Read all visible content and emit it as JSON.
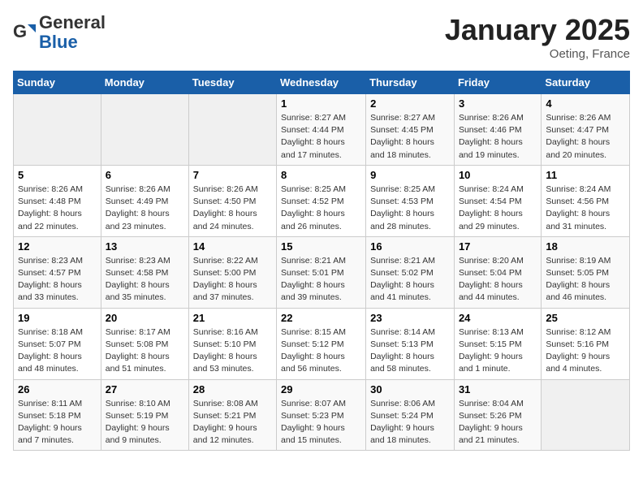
{
  "header": {
    "logo_general": "General",
    "logo_blue": "Blue",
    "month": "January 2025",
    "location": "Oeting, France"
  },
  "weekdays": [
    "Sunday",
    "Monday",
    "Tuesday",
    "Wednesday",
    "Thursday",
    "Friday",
    "Saturday"
  ],
  "weeks": [
    [
      {
        "day": "",
        "info": ""
      },
      {
        "day": "",
        "info": ""
      },
      {
        "day": "",
        "info": ""
      },
      {
        "day": "1",
        "info": "Sunrise: 8:27 AM\nSunset: 4:44 PM\nDaylight: 8 hours and 17 minutes."
      },
      {
        "day": "2",
        "info": "Sunrise: 8:27 AM\nSunset: 4:45 PM\nDaylight: 8 hours and 18 minutes."
      },
      {
        "day": "3",
        "info": "Sunrise: 8:26 AM\nSunset: 4:46 PM\nDaylight: 8 hours and 19 minutes."
      },
      {
        "day": "4",
        "info": "Sunrise: 8:26 AM\nSunset: 4:47 PM\nDaylight: 8 hours and 20 minutes."
      }
    ],
    [
      {
        "day": "5",
        "info": "Sunrise: 8:26 AM\nSunset: 4:48 PM\nDaylight: 8 hours and 22 minutes."
      },
      {
        "day": "6",
        "info": "Sunrise: 8:26 AM\nSunset: 4:49 PM\nDaylight: 8 hours and 23 minutes."
      },
      {
        "day": "7",
        "info": "Sunrise: 8:26 AM\nSunset: 4:50 PM\nDaylight: 8 hours and 24 minutes."
      },
      {
        "day": "8",
        "info": "Sunrise: 8:25 AM\nSunset: 4:52 PM\nDaylight: 8 hours and 26 minutes."
      },
      {
        "day": "9",
        "info": "Sunrise: 8:25 AM\nSunset: 4:53 PM\nDaylight: 8 hours and 28 minutes."
      },
      {
        "day": "10",
        "info": "Sunrise: 8:24 AM\nSunset: 4:54 PM\nDaylight: 8 hours and 29 minutes."
      },
      {
        "day": "11",
        "info": "Sunrise: 8:24 AM\nSunset: 4:56 PM\nDaylight: 8 hours and 31 minutes."
      }
    ],
    [
      {
        "day": "12",
        "info": "Sunrise: 8:23 AM\nSunset: 4:57 PM\nDaylight: 8 hours and 33 minutes."
      },
      {
        "day": "13",
        "info": "Sunrise: 8:23 AM\nSunset: 4:58 PM\nDaylight: 8 hours and 35 minutes."
      },
      {
        "day": "14",
        "info": "Sunrise: 8:22 AM\nSunset: 5:00 PM\nDaylight: 8 hours and 37 minutes."
      },
      {
        "day": "15",
        "info": "Sunrise: 8:21 AM\nSunset: 5:01 PM\nDaylight: 8 hours and 39 minutes."
      },
      {
        "day": "16",
        "info": "Sunrise: 8:21 AM\nSunset: 5:02 PM\nDaylight: 8 hours and 41 minutes."
      },
      {
        "day": "17",
        "info": "Sunrise: 8:20 AM\nSunset: 5:04 PM\nDaylight: 8 hours and 44 minutes."
      },
      {
        "day": "18",
        "info": "Sunrise: 8:19 AM\nSunset: 5:05 PM\nDaylight: 8 hours and 46 minutes."
      }
    ],
    [
      {
        "day": "19",
        "info": "Sunrise: 8:18 AM\nSunset: 5:07 PM\nDaylight: 8 hours and 48 minutes."
      },
      {
        "day": "20",
        "info": "Sunrise: 8:17 AM\nSunset: 5:08 PM\nDaylight: 8 hours and 51 minutes."
      },
      {
        "day": "21",
        "info": "Sunrise: 8:16 AM\nSunset: 5:10 PM\nDaylight: 8 hours and 53 minutes."
      },
      {
        "day": "22",
        "info": "Sunrise: 8:15 AM\nSunset: 5:12 PM\nDaylight: 8 hours and 56 minutes."
      },
      {
        "day": "23",
        "info": "Sunrise: 8:14 AM\nSunset: 5:13 PM\nDaylight: 8 hours and 58 minutes."
      },
      {
        "day": "24",
        "info": "Sunrise: 8:13 AM\nSunset: 5:15 PM\nDaylight: 9 hours and 1 minute."
      },
      {
        "day": "25",
        "info": "Sunrise: 8:12 AM\nSunset: 5:16 PM\nDaylight: 9 hours and 4 minutes."
      }
    ],
    [
      {
        "day": "26",
        "info": "Sunrise: 8:11 AM\nSunset: 5:18 PM\nDaylight: 9 hours and 7 minutes."
      },
      {
        "day": "27",
        "info": "Sunrise: 8:10 AM\nSunset: 5:19 PM\nDaylight: 9 hours and 9 minutes."
      },
      {
        "day": "28",
        "info": "Sunrise: 8:08 AM\nSunset: 5:21 PM\nDaylight: 9 hours and 12 minutes."
      },
      {
        "day": "29",
        "info": "Sunrise: 8:07 AM\nSunset: 5:23 PM\nDaylight: 9 hours and 15 minutes."
      },
      {
        "day": "30",
        "info": "Sunrise: 8:06 AM\nSunset: 5:24 PM\nDaylight: 9 hours and 18 minutes."
      },
      {
        "day": "31",
        "info": "Sunrise: 8:04 AM\nSunset: 5:26 PM\nDaylight: 9 hours and 21 minutes."
      },
      {
        "day": "",
        "info": ""
      }
    ]
  ]
}
